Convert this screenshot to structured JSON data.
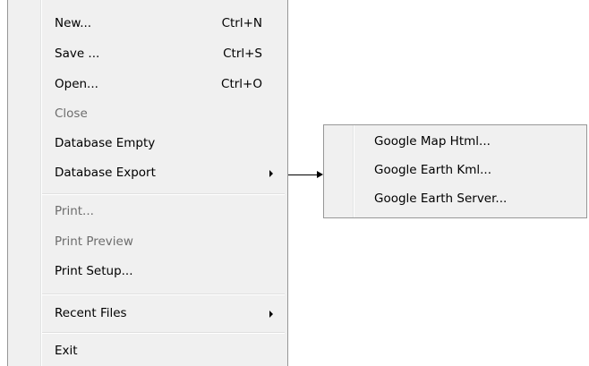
{
  "file_menu": {
    "items": [
      {
        "label": "New...",
        "shortcut": "Ctrl+N",
        "enabled": true
      },
      {
        "label": "Save ...",
        "shortcut": "Ctrl+S",
        "enabled": true
      },
      {
        "label": "Open...",
        "shortcut": "Ctrl+O",
        "enabled": true
      },
      {
        "label": "Close",
        "shortcut": "",
        "enabled": false
      },
      {
        "label": "Database Empty",
        "shortcut": "",
        "enabled": true
      },
      {
        "label": "Database Export",
        "shortcut": "",
        "enabled": true,
        "submenu": true
      },
      {
        "label": "Print...",
        "shortcut": "",
        "enabled": false
      },
      {
        "label": "Print Preview",
        "shortcut": "",
        "enabled": false
      },
      {
        "label": "Print Setup...",
        "shortcut": "",
        "enabled": true
      },
      {
        "label": "Recent Files",
        "shortcut": "",
        "enabled": true,
        "submenu": true
      },
      {
        "label": "Exit",
        "shortcut": "",
        "enabled": true
      }
    ]
  },
  "export_submenu": {
    "items": [
      {
        "label": "Google Map Html..."
      },
      {
        "label": "Google Earth Kml..."
      },
      {
        "label": "Google Earth Server..."
      }
    ]
  },
  "icons": {
    "submenu_arrow": "triangle-right",
    "connector_arrow": "arrow-right"
  },
  "colors": {
    "menu_background": "#f0f0f0",
    "menu_border": "#979797",
    "disabled_text": "#6d6d6d"
  }
}
